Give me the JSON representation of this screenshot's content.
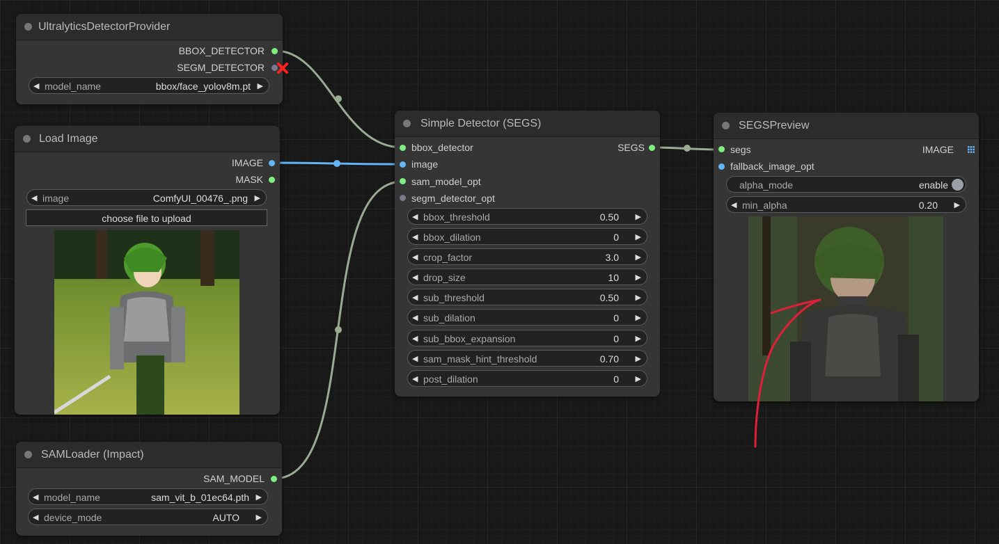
{
  "colors": {
    "canvas_bg": "#181818",
    "node_bg": "#353535",
    "title_bg": "#2c2c2c",
    "slot_green": "#7ff07f",
    "slot_blue": "#64b5f6",
    "slot_gray": "#7a7a8a",
    "link_gray": "#9aab93",
    "link_blue": "#64b5f6",
    "error_red": "#ff2020",
    "annotation_red": "#e0203a"
  },
  "nodes": {
    "ultralytics": {
      "title": "UltralyticsDetectorProvider",
      "outputs": [
        "BBOX_DETECTOR",
        "SEGM_DETECTOR"
      ],
      "widgets": [
        {
          "name": "model_name",
          "value": "bbox/face_yolov8m.pt"
        }
      ]
    },
    "load_image": {
      "title": "Load Image",
      "outputs": [
        "IMAGE",
        "MASK"
      ],
      "widgets": [
        {
          "name": "image",
          "value": "ComfyUI_00476_.png"
        }
      ],
      "upload_label": "choose file to upload"
    },
    "samloader": {
      "title": "SAMLoader (Impact)",
      "outputs": [
        "SAM_MODEL"
      ],
      "widgets": [
        {
          "name": "model_name",
          "value": "sam_vit_b_01ec64.pth"
        },
        {
          "name": "device_mode",
          "value": "AUTO"
        }
      ]
    },
    "simple_detector": {
      "title": "Simple Detector (SEGS)",
      "inputs": [
        "bbox_detector",
        "image",
        "sam_model_opt",
        "segm_detector_opt"
      ],
      "outputs": [
        "SEGS"
      ],
      "widgets": [
        {
          "name": "bbox_threshold",
          "value": "0.50"
        },
        {
          "name": "bbox_dilation",
          "value": "0"
        },
        {
          "name": "crop_factor",
          "value": "3.0"
        },
        {
          "name": "drop_size",
          "value": "10"
        },
        {
          "name": "sub_threshold",
          "value": "0.50"
        },
        {
          "name": "sub_dilation",
          "value": "0"
        },
        {
          "name": "sub_bbox_expansion",
          "value": "0"
        },
        {
          "name": "sam_mask_hint_threshold",
          "value": "0.70"
        },
        {
          "name": "post_dilation",
          "value": "0"
        }
      ]
    },
    "segs_preview": {
      "title": "SEGSPreview",
      "inputs": [
        "segs",
        "fallback_image_opt"
      ],
      "outputs": [
        "IMAGE"
      ],
      "widgets": [
        {
          "name": "alpha_mode",
          "value": "enable"
        },
        {
          "name": "min_alpha",
          "value": "0.20"
        }
      ]
    }
  }
}
